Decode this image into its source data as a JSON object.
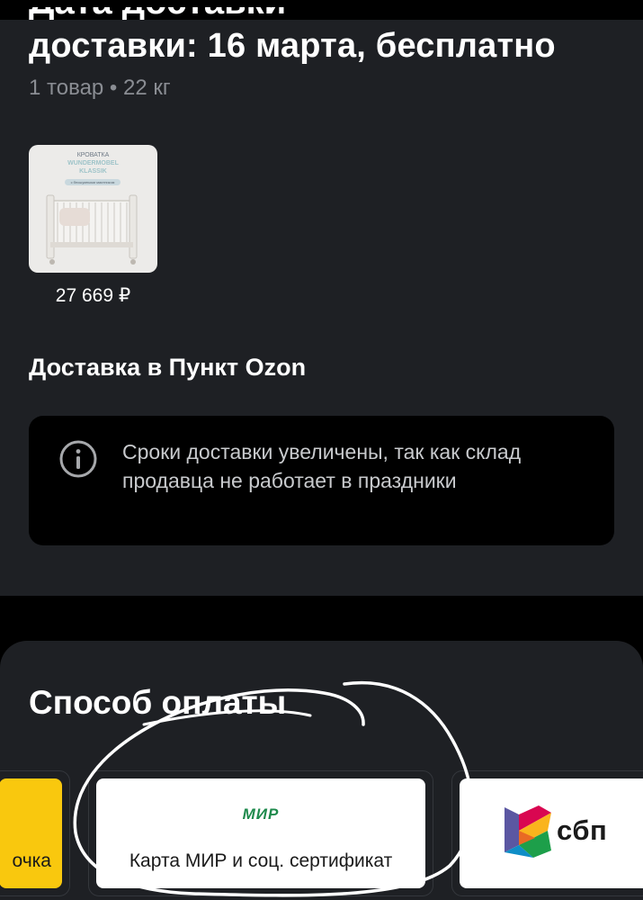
{
  "delivery": {
    "title_cut_text": "Дата доставки",
    "title": "доставки: 16 марта, бесплатно",
    "meta": "1 товар • 22 кг",
    "product": {
      "thumb_line1": "КРОВАТКА",
      "thumb_line2": "WUNDERMOBEL",
      "thumb_line3": "KLASSIK",
      "thumb_ribbon": "с бесшумными маятником",
      "price": "27 669 ₽"
    },
    "pickup_title": "Доставка в Пункт Ozon",
    "info_text": "Сроки доставки увеличены, так как склад продавца не работает в праздники",
    "info_icon": "info-circle-icon"
  },
  "payment": {
    "title": "Способ оплаты",
    "options": [
      {
        "label": "очка",
        "color": "#f9c80e"
      },
      {
        "logo": "МИР",
        "label": "Карта МИР и соц. сертификат",
        "logo_color": "#1e8a4c"
      },
      {
        "logo": "сбп",
        "logo_icon": "sbp-logo-icon"
      }
    ]
  },
  "colors": {
    "page_bg": "#000000",
    "card_bg": "#1e2024",
    "muted_text": "#8a8d93",
    "info_text": "#c8cacd",
    "scribble": "#ffffff"
  }
}
